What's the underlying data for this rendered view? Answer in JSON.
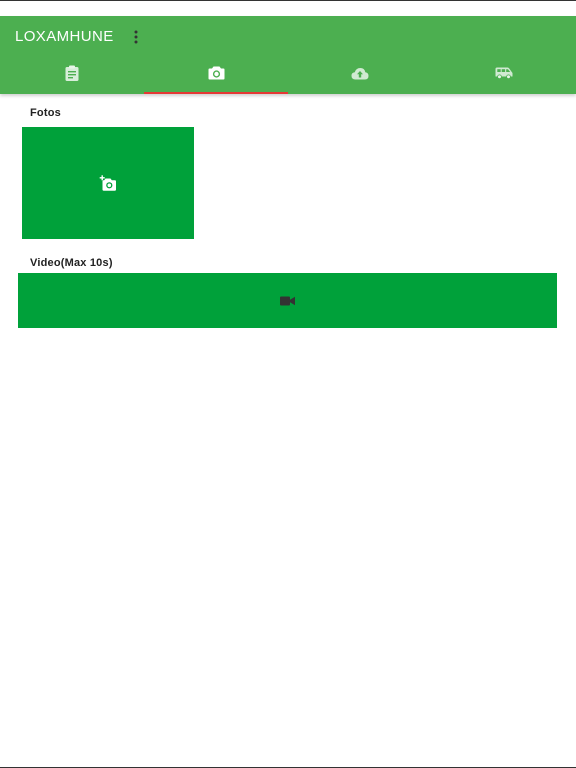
{
  "app": {
    "title": "LOXAMHUNE",
    "menu_icon": "more-vert-icon",
    "colors": {
      "toolbar": "#4caf50",
      "tab_indicator": "#e53935",
      "media_box": "#00a13a"
    }
  },
  "tabs": [
    {
      "icon": "clipboard-icon",
      "active": false
    },
    {
      "icon": "camera-icon",
      "active": true
    },
    {
      "icon": "cloud-upload-icon",
      "active": false
    },
    {
      "icon": "van-icon",
      "active": false
    }
  ],
  "photos": {
    "label": "Fotos",
    "icon": "add-photo-icon"
  },
  "video": {
    "label": "Video(Max 10s)",
    "icon": "videocam-icon"
  }
}
